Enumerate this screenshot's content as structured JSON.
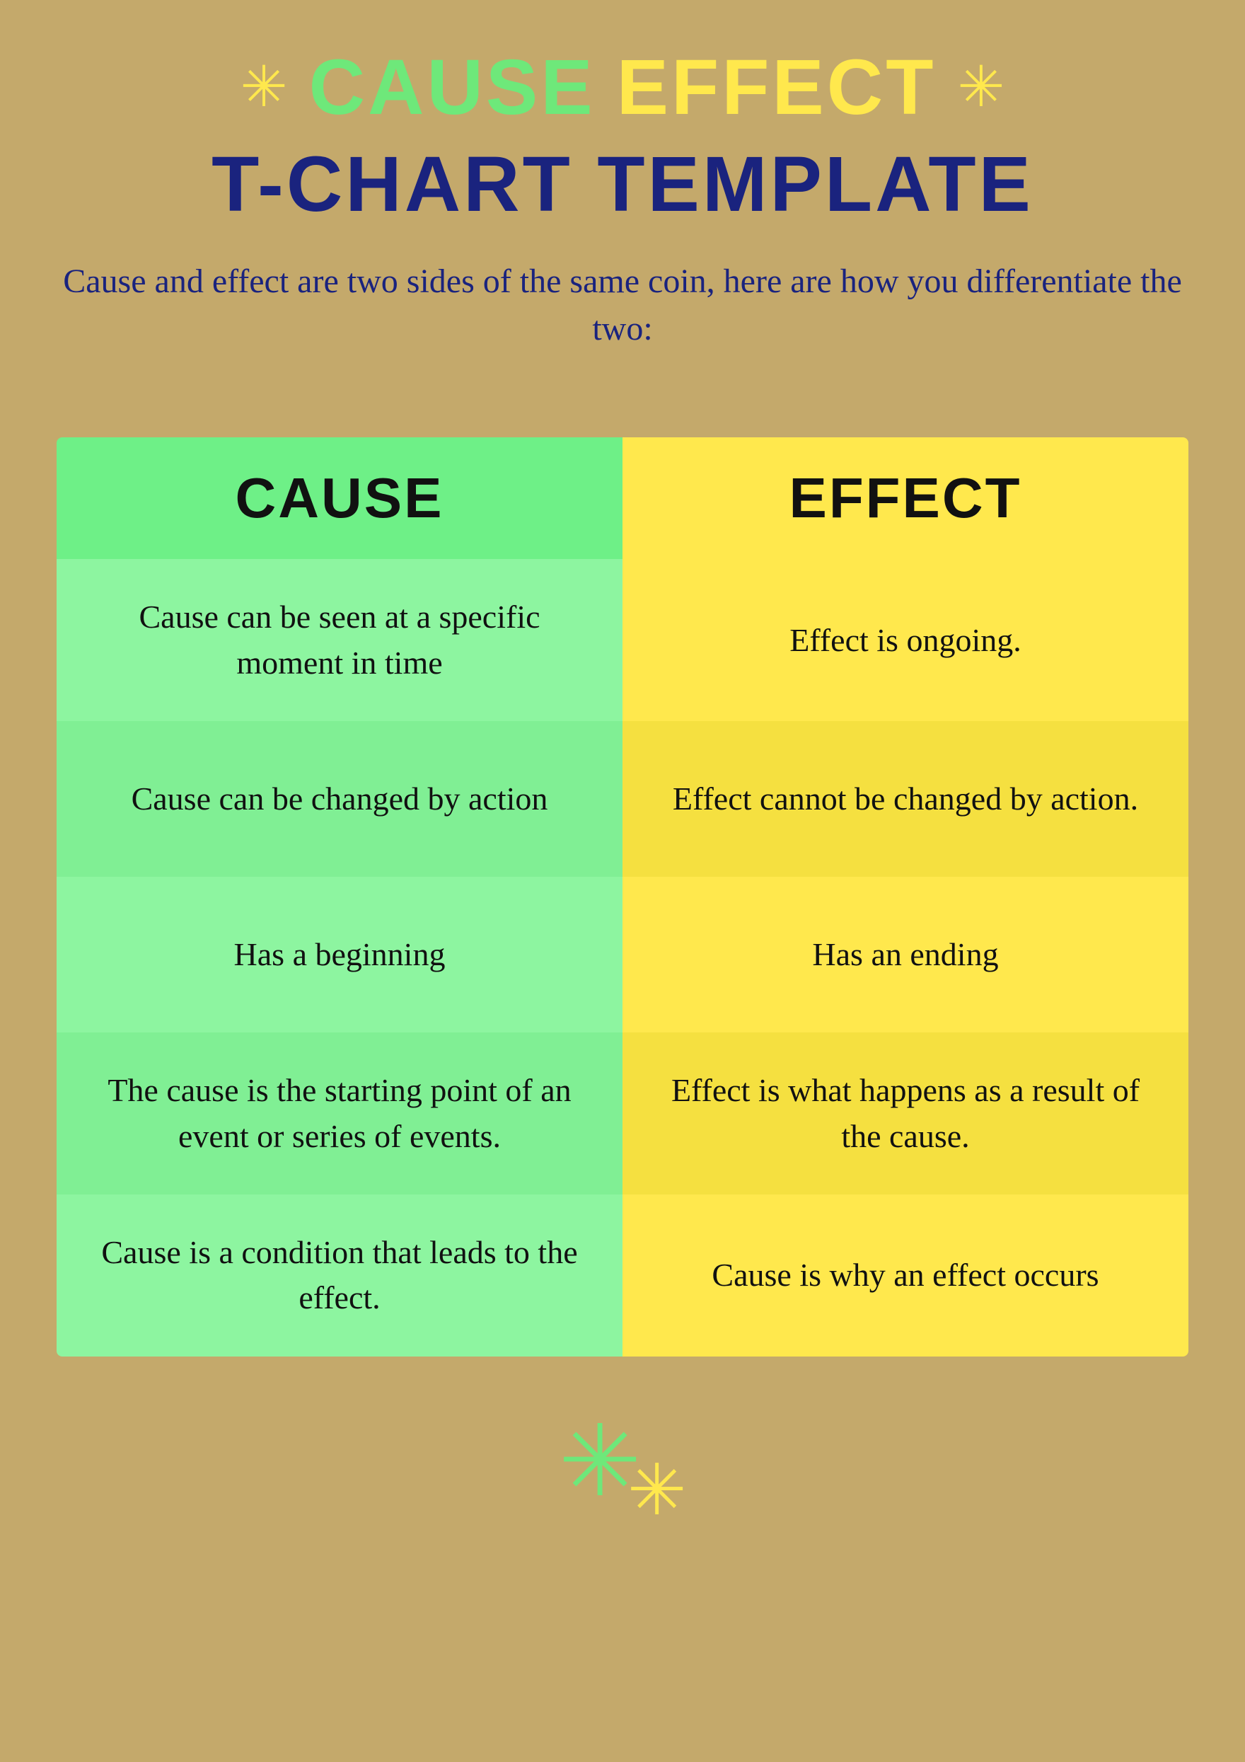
{
  "header": {
    "title_line1_part1": "CAUSE",
    "title_line1_part2": "EFFECT",
    "title_line2": "T-CHART TEMPLATE",
    "subtitle": "Cause and effect are two sides of the same coin, here are how you differentiate the two:"
  },
  "table": {
    "cause_header": "CAUSE",
    "effect_header": "EFFECT",
    "rows": [
      {
        "cause": "Cause can be seen at a specific moment in time",
        "effect": "Effect is ongoing."
      },
      {
        "cause": "Cause can be changed by action",
        "effect": "Effect cannot be changed by action."
      },
      {
        "cause": "Has a beginning",
        "effect": "Has an ending"
      },
      {
        "cause": "The cause is the starting point of an event or series of events.",
        "effect": "Effect is what happens as a result of the cause."
      },
      {
        "cause": "Cause is a condition that leads to the effect.",
        "effect": "Cause is why an effect occurs"
      }
    ]
  },
  "decorations": {
    "star_symbol": "✳",
    "star_yellow": "✳",
    "star_green": "✳"
  }
}
